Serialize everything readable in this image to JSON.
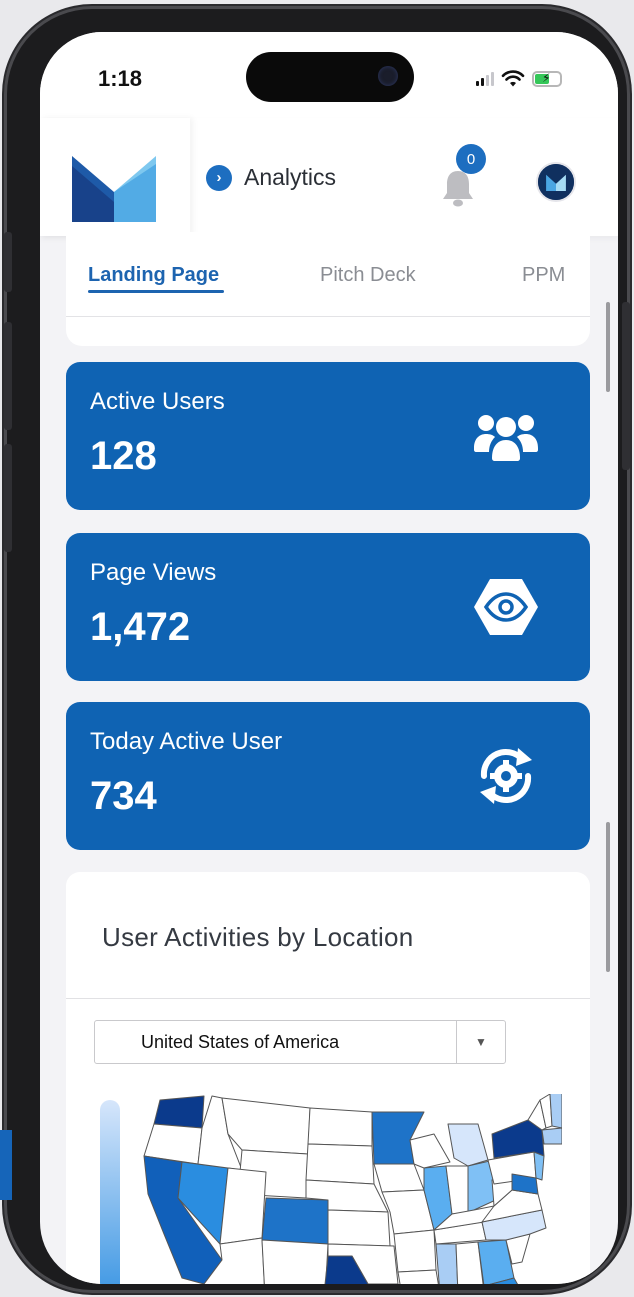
{
  "status_bar": {
    "time": "1:18"
  },
  "header": {
    "title": "Analytics",
    "notification_count": "0"
  },
  "tabs": [
    {
      "label": "Landing Page",
      "active": true
    },
    {
      "label": "Pitch Deck",
      "active": false
    },
    {
      "label": "PPM",
      "active": false
    }
  ],
  "stats": [
    {
      "label": "Active Users",
      "value": "128",
      "icon": "users-icon"
    },
    {
      "label": "Page Views",
      "value": "1,472",
      "icon": "eye-icon"
    },
    {
      "label": "Today Active User",
      "value": "734",
      "icon": "refresh-gear-icon"
    }
  ],
  "map_card": {
    "title": "User Activities by Location",
    "country_select": {
      "value": "United States of America"
    }
  },
  "colors": {
    "primary": "#0f63b3",
    "accent": "#1d6ec0",
    "tab_active": "#1d64b0",
    "map_dark": "#0b3a8c",
    "map_mid": "#2a7fd2",
    "map_light": "#a9cdf4"
  }
}
